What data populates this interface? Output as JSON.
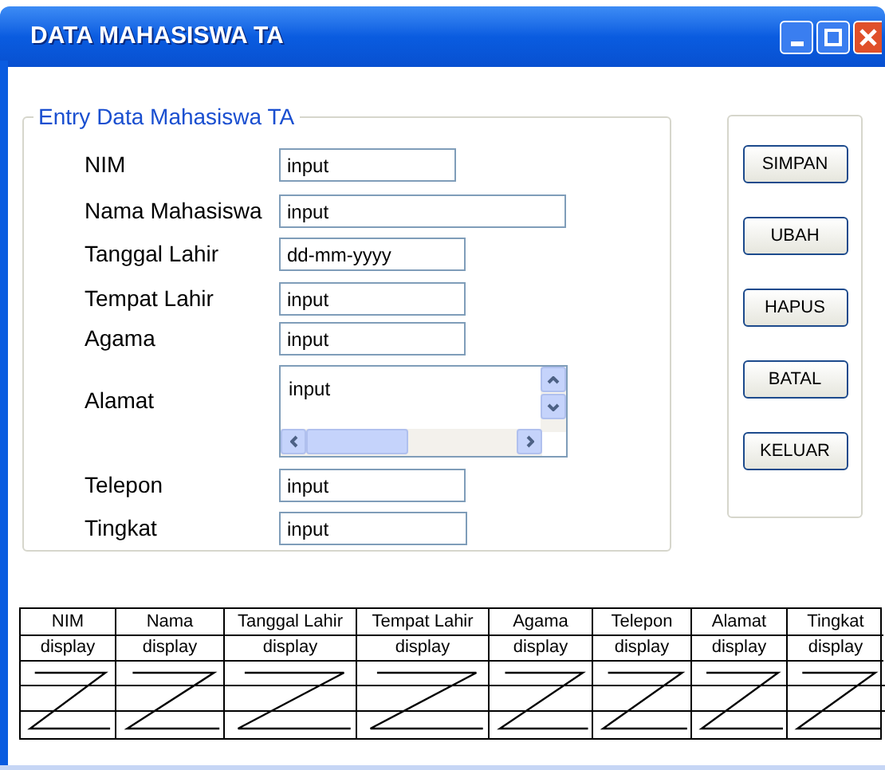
{
  "window": {
    "title": "DATA MAHASISWA TA"
  },
  "form": {
    "legend": "Entry Data Mahasiswa TA",
    "fields": [
      {
        "label": "NIM",
        "value": "input",
        "kind": "text"
      },
      {
        "label": "Nama Mahasiswa",
        "value": "input",
        "kind": "text"
      },
      {
        "label": "Tanggal Lahir",
        "value": "dd-mm-yyyy",
        "kind": "text"
      },
      {
        "label": "Tempat Lahir",
        "value": "input",
        "kind": "text"
      },
      {
        "label": "Agama",
        "value": "input",
        "kind": "text"
      },
      {
        "label": "Alamat",
        "value": "input",
        "kind": "textarea"
      },
      {
        "label": "Telepon",
        "value": "input",
        "kind": "text"
      },
      {
        "label": "Tingkat",
        "value": "input",
        "kind": "text"
      }
    ]
  },
  "buttons": [
    "SIMPAN",
    "UBAH",
    "HAPUS",
    "BATAL",
    "KELUAR"
  ],
  "table": {
    "columns": [
      {
        "header": "NIM",
        "cell": "display"
      },
      {
        "header": "Nama",
        "cell": "display"
      },
      {
        "header": "Tanggal Lahir",
        "cell": "display"
      },
      {
        "header": "Tempat Lahir",
        "cell": "display"
      },
      {
        "header": "Agama",
        "cell": "display"
      },
      {
        "header": "Telepon",
        "cell": "display"
      },
      {
        "header": "Alamat",
        "cell": "display"
      },
      {
        "header": "Tingkat",
        "cell": "display"
      }
    ]
  }
}
